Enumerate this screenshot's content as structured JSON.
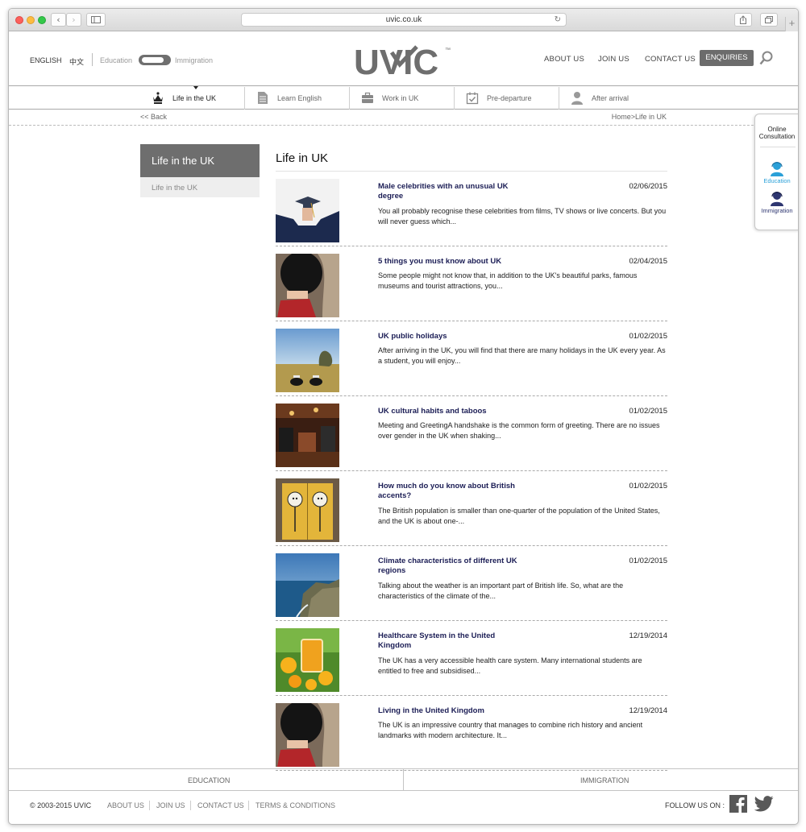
{
  "browser": {
    "url": "uvic.co.uk"
  },
  "header": {
    "lang_english": "ENGLISH",
    "lang_chinese": "中文",
    "toggle_left": "Education",
    "toggle_right": "Immigration",
    "logo_text": "UVIC",
    "logo_tm": "™",
    "nav": [
      "ABOUT US",
      "JOIN US",
      "CONTACT US"
    ],
    "enquiries": "ENQUIRIES"
  },
  "subnav": [
    {
      "label": "Life in the UK",
      "icon": "crown-icon"
    },
    {
      "label": "Learn English",
      "icon": "document-icon"
    },
    {
      "label": "Work in UK",
      "icon": "briefcase-icon"
    },
    {
      "label": "Pre-departure",
      "icon": "calendar-check-icon"
    },
    {
      "label": "After arrival",
      "icon": "person-icon"
    }
  ],
  "crumbs": {
    "back": "<< Back",
    "path": "Home>Life in UK"
  },
  "sidebar": {
    "heading": "Life in the UK",
    "item": "Life in the UK"
  },
  "main": {
    "title": "Life in UK"
  },
  "articles": [
    {
      "title": "Male celebrities with an unusual UK degree",
      "date": "02/06/2015",
      "summary": "You all probably recognise these celebrities from films, TV shows or live concerts. But you will never guess which..."
    },
    {
      "title": "5 things you must know about UK",
      "date": "02/04/2015",
      "summary": "Some people might not know that, in addition to the UK's beautiful parks, famous museums and tourist attractions, you..."
    },
    {
      "title": "UK public holidays",
      "date": "01/02/2015",
      "summary": "After arriving in the UK, you will find that there are many holidays in the UK every year. As a student, you will enjoy..."
    },
    {
      "title": "UK cultural habits and taboos",
      "date": "01/02/2015",
      "summary": "Meeting and GreetingA handshake is the common form of greeting. There are no issues over gender in the UK when shaking..."
    },
    {
      "title": "How much do you know about British accents?",
      "date": "01/02/2015",
      "summary": "The British population is smaller than one-quarter of the population of the United States, and the UK is about one-..."
    },
    {
      "title": "Climate characteristics of different UK regions",
      "date": "01/02/2015",
      "summary": "Talking about the weather is an important part of British life. So, what are the characteristics of the climate of the..."
    },
    {
      "title": "Healthcare System in the United Kingdom",
      "date": "12/19/2014",
      "summary": "The UK has a very accessible health care system. Many international students are entitled to free and subsidised..."
    },
    {
      "title": "Living in the United Kingdom",
      "date": "12/19/2014",
      "summary": "The UK is an impressive country that manages to combine rich history and ancient landmarks with modern architecture. It..."
    }
  ],
  "consult": {
    "title_line1": "Online",
    "title_line2": "Consultation",
    "education": "Education",
    "immigration": "Immigration"
  },
  "footer": {
    "tab_left": "EDUCATION",
    "tab_right": "IMMIGRATION",
    "copyright": "© 2003-2015 UVIC",
    "links": [
      "ABOUT US",
      "JOIN US",
      "CONTACT US",
      "TERMS & CONDITIONS"
    ],
    "follow": "FOLLOW US ON :"
  },
  "colors": {
    "accent_gray": "#6c6c6c",
    "title_navy": "#1b1d55",
    "education_blue": "#2aa0d8",
    "immigration_navy": "#2d3570"
  }
}
